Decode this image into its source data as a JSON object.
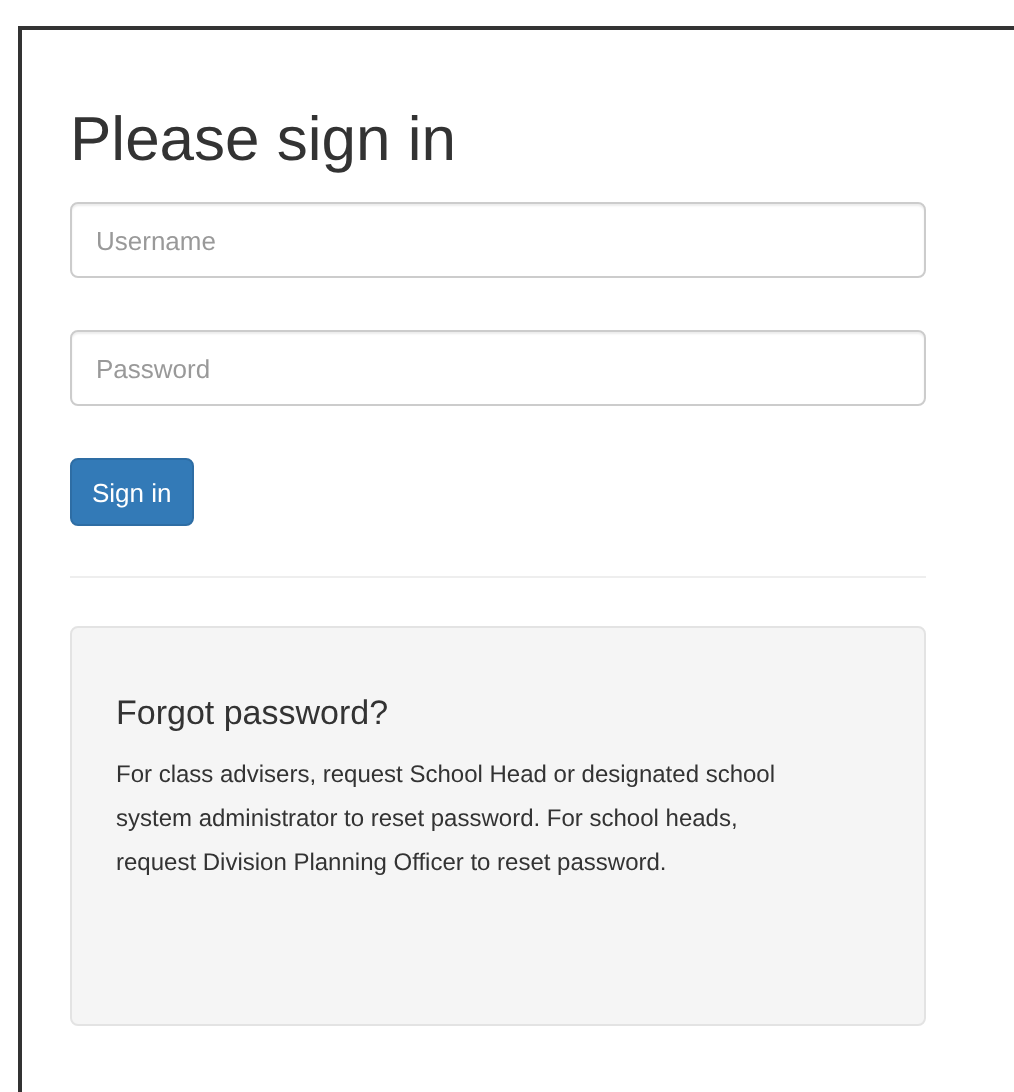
{
  "title": "Please sign in",
  "fields": [
    {
      "placeholder": "Username"
    },
    {
      "placeholder": "Password"
    }
  ],
  "submit": "Sign in",
  "help": {
    "heading": "Forgot password?",
    "text": "For class advisers, request School Head or designated school system administrator to reset password. For school heads, request Division Planning Officer to reset password."
  }
}
